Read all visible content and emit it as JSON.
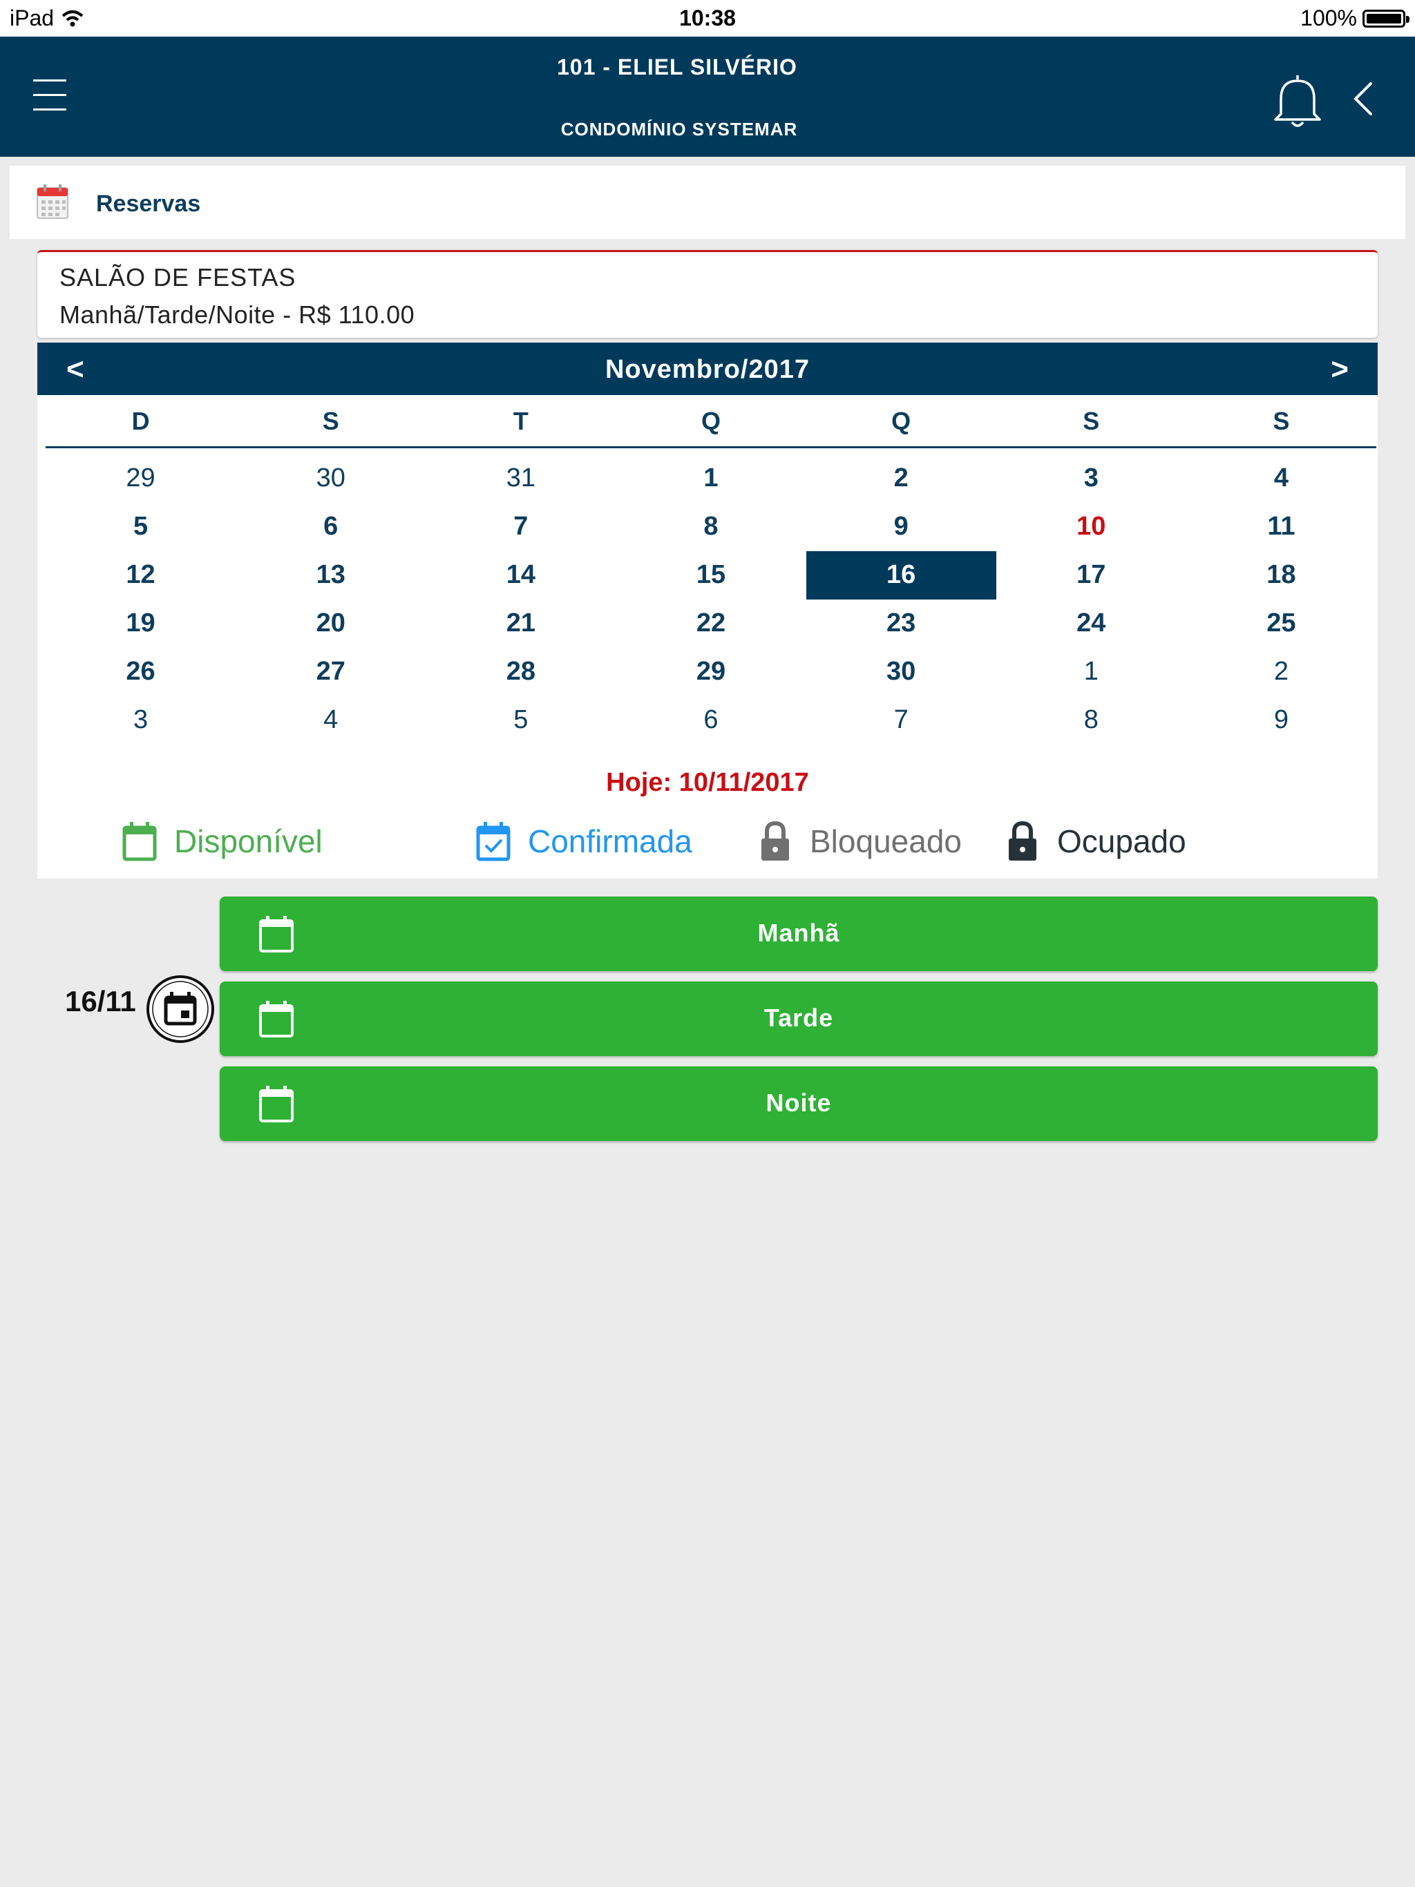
{
  "status_bar": {
    "device": "iPad",
    "time": "10:38",
    "battery": "100%"
  },
  "header": {
    "title": "101 - ELIEL SILVÉRIO",
    "subtitle": "CONDOMÍNIO SYSTEMAR"
  },
  "section": {
    "title": "Reservas"
  },
  "venue": {
    "name": "SALÃO DE FESTAS",
    "price": "Manhã/Tarde/Noite - R$ 110.00"
  },
  "calendar": {
    "month": "Novembro/2017",
    "prev": "<",
    "next": ">",
    "weekdays": [
      "D",
      "S",
      "T",
      "Q",
      "Q",
      "S",
      "S"
    ],
    "weeks": [
      [
        {
          "d": "29",
          "in": false
        },
        {
          "d": "30",
          "in": false
        },
        {
          "d": "31",
          "in": false
        },
        {
          "d": "1",
          "in": true
        },
        {
          "d": "2",
          "in": true
        },
        {
          "d": "3",
          "in": true
        },
        {
          "d": "4",
          "in": true
        }
      ],
      [
        {
          "d": "5",
          "in": true
        },
        {
          "d": "6",
          "in": true
        },
        {
          "d": "7",
          "in": true
        },
        {
          "d": "8",
          "in": true
        },
        {
          "d": "9",
          "in": true
        },
        {
          "d": "10",
          "in": true,
          "today": true
        },
        {
          "d": "11",
          "in": true
        }
      ],
      [
        {
          "d": "12",
          "in": true
        },
        {
          "d": "13",
          "in": true
        },
        {
          "d": "14",
          "in": true
        },
        {
          "d": "15",
          "in": true
        },
        {
          "d": "16",
          "in": true,
          "selected": true
        },
        {
          "d": "17",
          "in": true
        },
        {
          "d": "18",
          "in": true
        }
      ],
      [
        {
          "d": "19",
          "in": true
        },
        {
          "d": "20",
          "in": true
        },
        {
          "d": "21",
          "in": true
        },
        {
          "d": "22",
          "in": true
        },
        {
          "d": "23",
          "in": true
        },
        {
          "d": "24",
          "in": true
        },
        {
          "d": "25",
          "in": true
        }
      ],
      [
        {
          "d": "26",
          "in": true
        },
        {
          "d": "27",
          "in": true
        },
        {
          "d": "28",
          "in": true
        },
        {
          "d": "29",
          "in": true
        },
        {
          "d": "30",
          "in": true
        },
        {
          "d": "1",
          "in": false
        },
        {
          "d": "2",
          "in": false
        }
      ],
      [
        {
          "d": "3",
          "in": false
        },
        {
          "d": "4",
          "in": false
        },
        {
          "d": "5",
          "in": false
        },
        {
          "d": "6",
          "in": false
        },
        {
          "d": "7",
          "in": false
        },
        {
          "d": "8",
          "in": false
        },
        {
          "d": "9",
          "in": false
        }
      ]
    ],
    "today_label": "Hoje: 10/11/2017"
  },
  "legend": [
    {
      "label": "Disponível",
      "icon": "calendar-icon",
      "color": "#4caf50"
    },
    {
      "label": "Confirmada",
      "icon": "calendar-check-icon",
      "color": "#2196f3"
    },
    {
      "label": "Bloqueado",
      "icon": "lock-icon",
      "color": "#707070"
    },
    {
      "label": "Ocupado",
      "icon": "lock-icon",
      "color": "#263238"
    }
  ],
  "selected_day": {
    "label": "16/11"
  },
  "slots": [
    {
      "label": "Manhã"
    },
    {
      "label": "Tarde"
    },
    {
      "label": "Noite"
    }
  ],
  "colors": {
    "header": "#003a5b",
    "accent_red": "#c80e14",
    "slot_green": "#2eb135",
    "background": "#ebebeb"
  }
}
